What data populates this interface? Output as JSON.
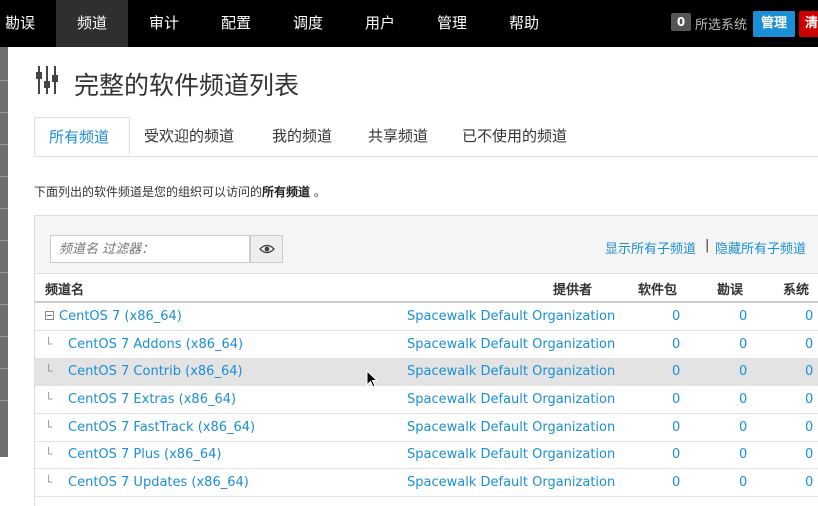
{
  "nav": {
    "items": [
      {
        "label": "勘误"
      },
      {
        "label": "频道"
      },
      {
        "label": "审计"
      },
      {
        "label": "配置"
      },
      {
        "label": "调度"
      },
      {
        "label": "用户"
      },
      {
        "label": "管理"
      },
      {
        "label": "帮助"
      }
    ],
    "selected_count": "0",
    "selected_label": "所选系统",
    "admin_button": "管理",
    "clear_button": "清"
  },
  "page": {
    "title": "完整的软件频道列表",
    "tabs": [
      {
        "label": "所有频道"
      },
      {
        "label": "受欢迎的频道"
      },
      {
        "label": "我的频道"
      },
      {
        "label": "共享频道"
      },
      {
        "label": "已不使用的频道"
      }
    ],
    "intro_prefix": "下面列出的软件频道是您的组织可以访问的",
    "intro_bold": "所有频道",
    "intro_suffix": "。"
  },
  "filter": {
    "placeholder": "频道名 过滤器：",
    "show_all": "显示所有子频道",
    "separator": "|",
    "hide_all": "隐藏所有子频道"
  },
  "table": {
    "headers": {
      "name": "频道名",
      "provider": "提供者",
      "packages": "软件包",
      "errata": "勘误",
      "systems": "系统"
    },
    "rows": [
      {
        "name": "CentOS 7 (x86_64)",
        "provider": "Spacewalk Default Organization",
        "packages": "0",
        "errata": "0",
        "systems": "0",
        "tree": ""
      },
      {
        "name": "CentOS 7 Addons (x86_64)",
        "provider": "Spacewalk Default Organization",
        "packages": "0",
        "errata": "0",
        "systems": "0",
        "tree": "└"
      },
      {
        "name": "CentOS 7 Contrib (x86_64)",
        "provider": "Spacewalk Default Organization",
        "packages": "0",
        "errata": "0",
        "systems": "0",
        "tree": "└"
      },
      {
        "name": "CentOS 7 Extras (x86_64)",
        "provider": "Spacewalk Default Organization",
        "packages": "0",
        "errata": "0",
        "systems": "0",
        "tree": "└"
      },
      {
        "name": "CentOS 7 FastTrack (x86_64)",
        "provider": "Spacewalk Default Organization",
        "packages": "0",
        "errata": "0",
        "systems": "0",
        "tree": "└"
      },
      {
        "name": "CentOS 7 Plus (x86_64)",
        "provider": "Spacewalk Default Organization",
        "packages": "0",
        "errata": "0",
        "systems": "0",
        "tree": "└"
      },
      {
        "name": "CentOS 7 Updates (x86_64)",
        "provider": "Spacewalk Default Organization",
        "packages": "0",
        "errata": "0",
        "systems": "0",
        "tree": "└"
      }
    ]
  },
  "icons": {
    "title": "sliders-icon",
    "filter": "eye-icon",
    "collapse": "minus-square-icon",
    "cursor": "mouse-pointer-icon"
  }
}
